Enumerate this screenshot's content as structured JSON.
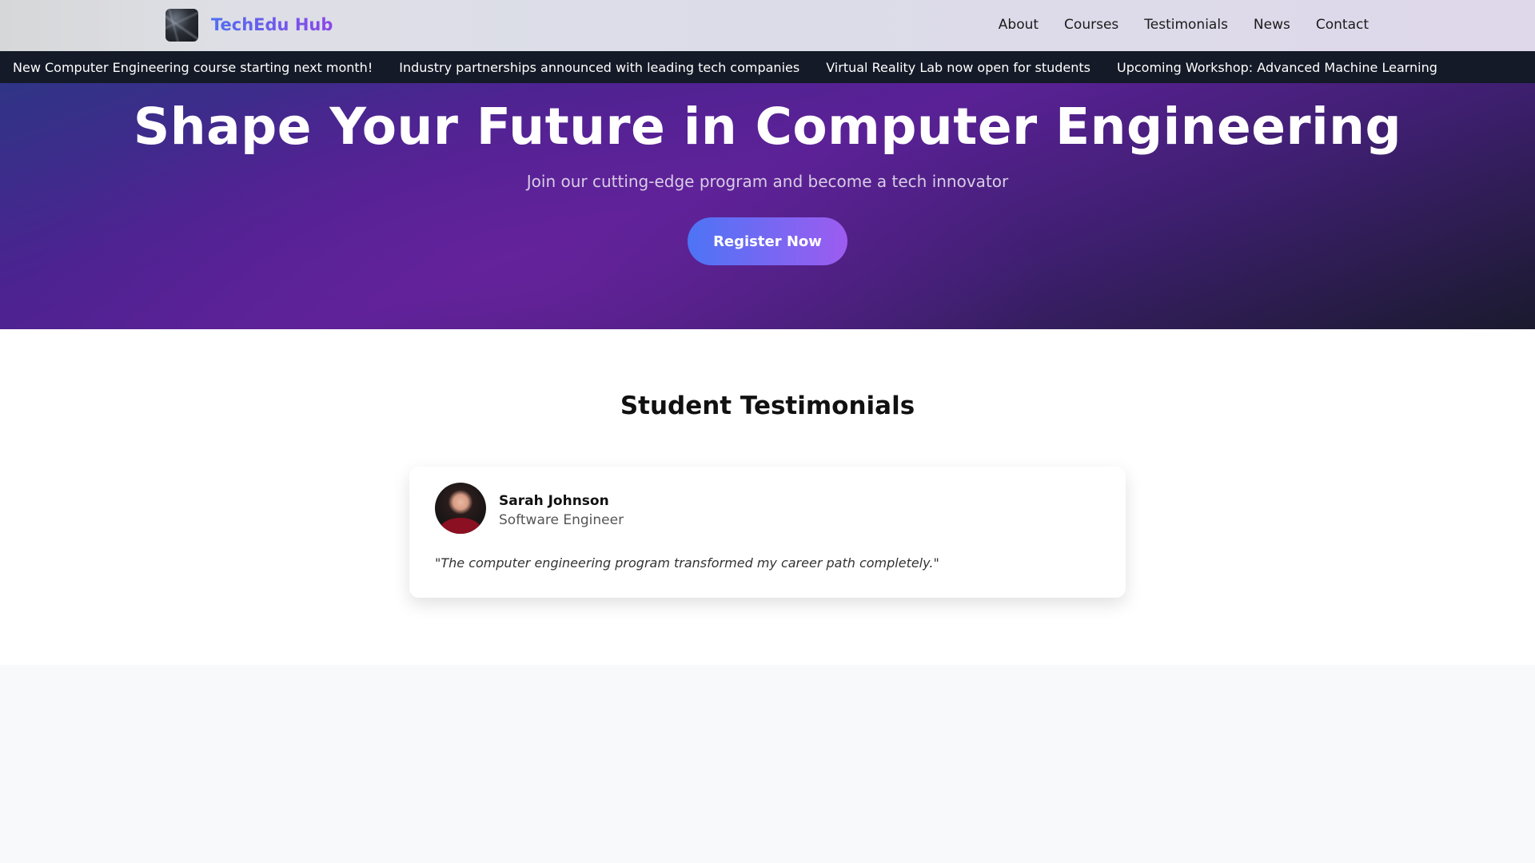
{
  "navbar": {
    "brand": "TechEdu Hub",
    "links": [
      "About",
      "Courses",
      "Testimonials",
      "News",
      "Contact"
    ]
  },
  "ticker": {
    "items": [
      "New Computer Engineering course starting next month!",
      "Industry partnerships announced with leading tech companies",
      "Virtual Reality Lab now open for students",
      "Upcoming Workshop: Advanced Machine Learning"
    ]
  },
  "hero": {
    "title": "Shape Your Future in Computer Engineering",
    "subtitle": "Join our cutting-edge program and become a tech innovator",
    "cta_label": "Register Now"
  },
  "testimonials": {
    "heading": "Student Testimonials",
    "items": [
      {
        "name": "Sarah Johnson",
        "role": "Software Engineer",
        "quote": "\"The computer engineering program transformed my career path completely.\""
      }
    ]
  },
  "colors": {
    "brand_gradient_start": "#4f6ff0",
    "brand_gradient_end": "#8b47e8",
    "ticker_bg": "#141a27",
    "hero_purple": "#5a2196",
    "button_start": "#4d74f5",
    "button_end": "#9d5cf0"
  }
}
